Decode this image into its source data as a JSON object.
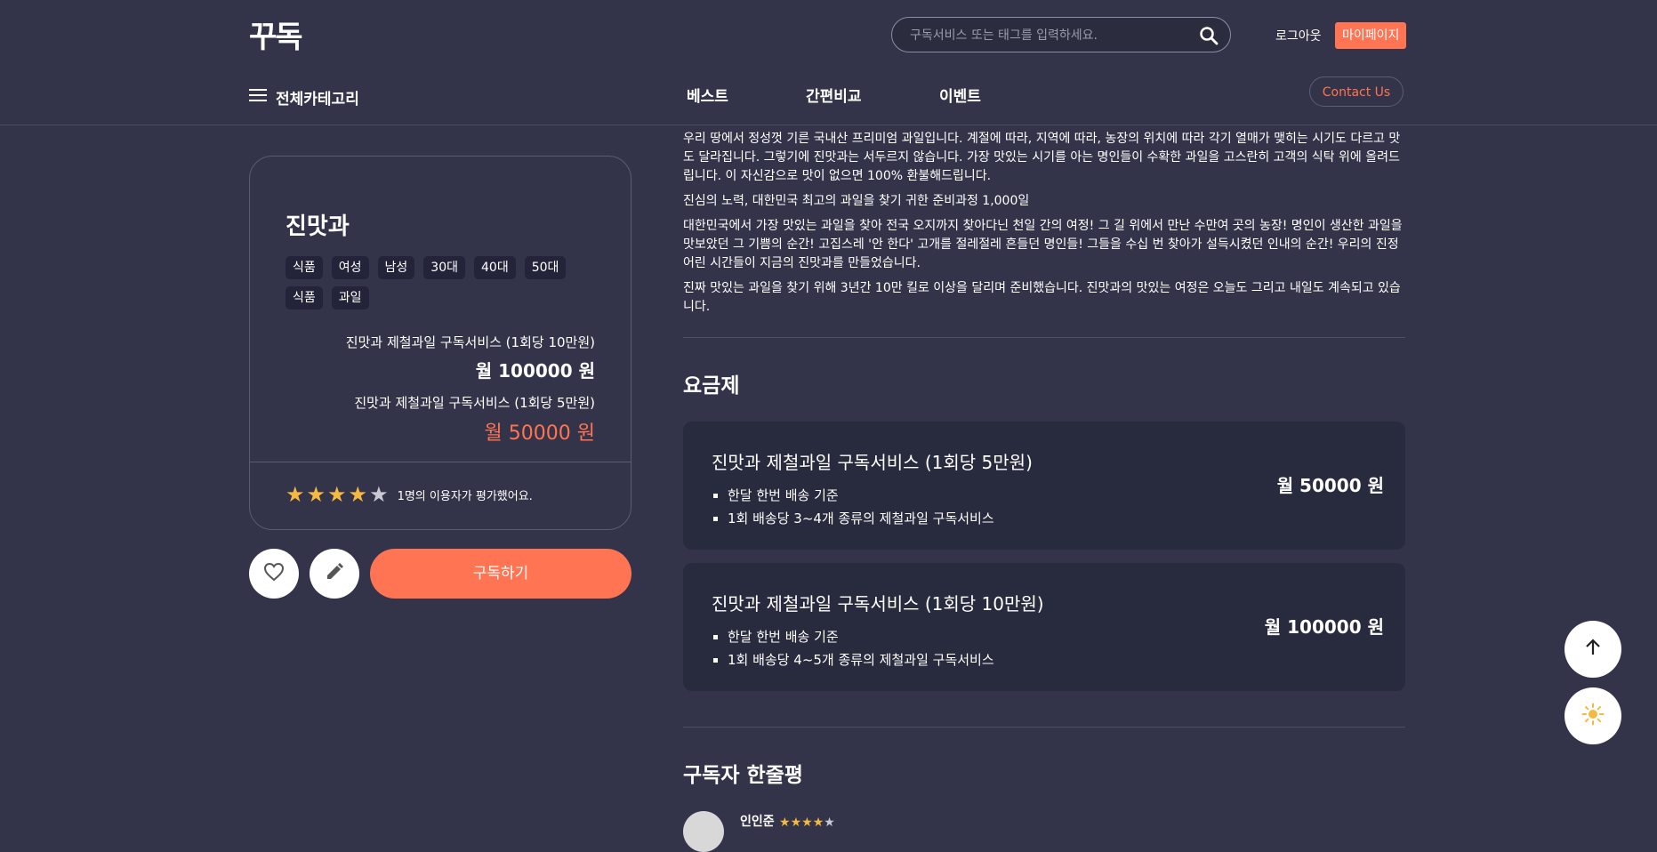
{
  "header": {
    "logo": "꾸독",
    "search_placeholder": "구독서비스 또는 태그를 입력하세요.",
    "logout": "로그아웃",
    "mypage": "마이페이지"
  },
  "nav": {
    "category": "전체카테고리",
    "links": [
      "베스트",
      "간편비교",
      "이벤트"
    ],
    "contact": "Contact Us"
  },
  "product": {
    "name": "진맛과",
    "tags": [
      "식품",
      "여성",
      "남성",
      "30대",
      "40대",
      "50대",
      "식품",
      "과일"
    ],
    "summary": [
      {
        "name": "진맛과 제철과일 구독서비스 (1회당 10만원)",
        "price": "월 100000 원"
      },
      {
        "name": "진맛과 제철과일 구독서비스 (1회당 5만원)",
        "price": "월 50000 원"
      }
    ],
    "rating": 4,
    "rating_max": 5,
    "rating_text": "1명의 이용자가 평가했어요.",
    "subscribe_label": "구독하기"
  },
  "description": [
    "우리 땅에서 정성껏 기른 국내산 프리미엄 과일입니다. 계절에 따라, 지역에 따라, 농장의 위치에 따라 각기 열매가 맺히는 시기도 다르고 맛도 달라집니다. 그렇기에 진맛과는 서두르지 않습니다. 가장 맛있는 시기를 아는 명인들이 수확한 과일을 고스란히 고객의 식탁 위에 올려드립니다. 이 자신감으로 맛이 없으면 100% 환불해드립니다.",
    "진심의 노력, 대한민국 최고의 과일을 찾기 귀한 준비과정 1,000일",
    "대한민국에서 가장 맛있는 과일을 찾아 전국 오지까지 찾아다닌 천일 간의 여정! 그 길 위에서 만난 수만여 곳의 농장! 명인이 생산한 과일을 맛보았던 그 기쁨의 순간! 고집스레 '안 한다' 고개를 절레절레 흔들던 명인들! 그들을 수십 번 찾아가 설득시켰던 인내의 순간! 우리의 진정 어린 시간들이 지금의 진맛과를 만들었습니다.",
    "진짜 맛있는 과일을 찾기 위해 3년간 10만 킬로 이상을 달리며 준비했습니다. 진맛과의 맛있는 여정은 오늘도 그리고 내일도 계속되고 있습니다."
  ],
  "plans_section": {
    "title": "요금제",
    "plans": [
      {
        "name": "진맛과 제철과일 구독서비스 (1회당 5만원)",
        "features": [
          "한달 한번 배송 기준",
          "1회 배송당 3~4개 종류의 제철과일 구독서비스"
        ],
        "price": "월 50000 원"
      },
      {
        "name": "진맛과 제철과일 구독서비스 (1회당 10만원)",
        "features": [
          "한달 한번 배송 기준",
          "1회 배송당 4~5개 종류의 제철과일 구독서비스"
        ],
        "price": "월 100000 원"
      }
    ]
  },
  "reviews_section": {
    "title": "구독자 한줄평",
    "reviews": [
      {
        "name": "인인준",
        "rating": 4
      }
    ]
  },
  "icons": {
    "menu": "menu-icon",
    "search": "search-icon",
    "heart": "heart-icon",
    "pencil": "pencil-icon",
    "arrow_up": "arrow-up-icon",
    "sun": "sun-icon",
    "star": "star-icon"
  },
  "colors": {
    "background": "#33344a",
    "accent": "#ff7452",
    "star_filled": "#f5b942",
    "star_empty": "#c9cad3",
    "panel": "#282a3e"
  }
}
